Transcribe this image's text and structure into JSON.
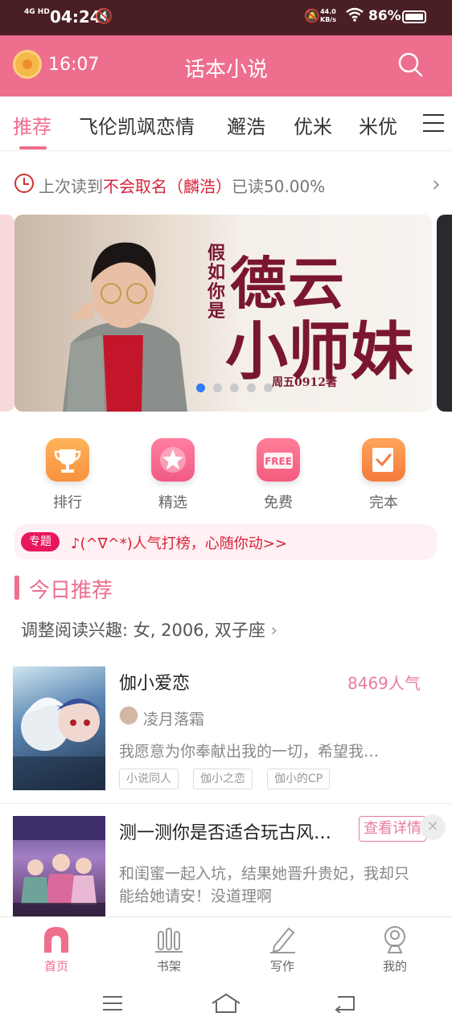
{
  "status_bar": {
    "network": "4G HD",
    "time": "04:24",
    "speed_value": "44.0",
    "speed_unit": "KB/s",
    "battery": "86%"
  },
  "header": {
    "time": "16:07",
    "title": "话本小说"
  },
  "tabs": [
    "推荐",
    "飞伦凯飒恋情",
    "邂浩",
    "优米",
    "米优"
  ],
  "last_read": {
    "prefix": "上次读到",
    "book": "不会取名（麟浩）",
    "progress": "已读50.00%"
  },
  "banner": {
    "vertical_text": "假如你是",
    "title_line1": "德云",
    "title_line2": "小师妹",
    "author": "周五0912著",
    "slide_count": 5,
    "active_slide": 1
  },
  "quick_entries": [
    {
      "label": "排行",
      "icon": "trophy-icon",
      "color": "#f7913d"
    },
    {
      "label": "精选",
      "icon": "star-icon",
      "color": "#f25a85"
    },
    {
      "label": "免费",
      "icon": "free-icon",
      "color": "#f45b7e",
      "icon_text": "FREE"
    },
    {
      "label": "完本",
      "icon": "checkbook-icon",
      "color": "#f57a3b"
    }
  ],
  "topic": {
    "badge": "专题",
    "text": "♪(^∇^*)人气打榜，心随你动>>"
  },
  "section": {
    "title": "今日推荐",
    "interest": "调整阅读兴趣: 女, 2006, 双子座"
  },
  "books": [
    {
      "title": "伽小爱恋",
      "popularity": "8469人气",
      "author": "凌月落霜",
      "description": "我愿意为你奉献出我的一切，希望我…",
      "tags": [
        "小说同人",
        "伽小之恋",
        "伽小的CP"
      ]
    },
    {
      "title": "测一测你是否适合玩古风…",
      "button": "查看详情",
      "description_line1": "和闺蜜一起入坑，结果她晋升贵妃，我却只",
      "description_line2": "能给她请安！没道理啊"
    }
  ],
  "bottom_nav": [
    {
      "label": "首页",
      "active": true
    },
    {
      "label": "书架",
      "active": false
    },
    {
      "label": "写作",
      "active": false
    },
    {
      "label": "我的",
      "active": false
    }
  ],
  "colors": {
    "brand": "#ee6e8e",
    "status_bar": "#4a1f24",
    "accent_red": "#d9233b",
    "dot_active": "#2e7cf6"
  }
}
